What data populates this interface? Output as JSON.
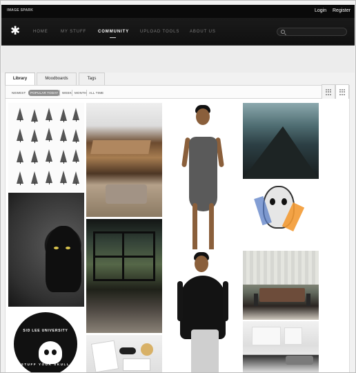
{
  "topbar": {
    "brand": "IMAGE SPARK",
    "login": "Login",
    "register": "Register"
  },
  "nav": {
    "logo": "✱",
    "items": [
      "HOME",
      "MY STUFF",
      "COMMUNITY",
      "UPLOAD TOOLS",
      "ABOUT US"
    ],
    "active": "COMMUNITY"
  },
  "search": {
    "placeholder": ""
  },
  "tabs": [
    "Library",
    "Moodboards",
    "Tags"
  ],
  "filters": [
    "NEWEST",
    "POPULAR TODAY",
    "WEEK",
    "MONTH",
    "ALL TIME"
  ],
  "active_filter": "POPULAR TODAY",
  "view": {
    "grid": "grid-view-icon",
    "list": "list-view-icon"
  },
  "gallery": {
    "sticker_top": "SID LEE UNIVERSITY",
    "sticker_bottom": "STUFF YOUR SKULL"
  }
}
